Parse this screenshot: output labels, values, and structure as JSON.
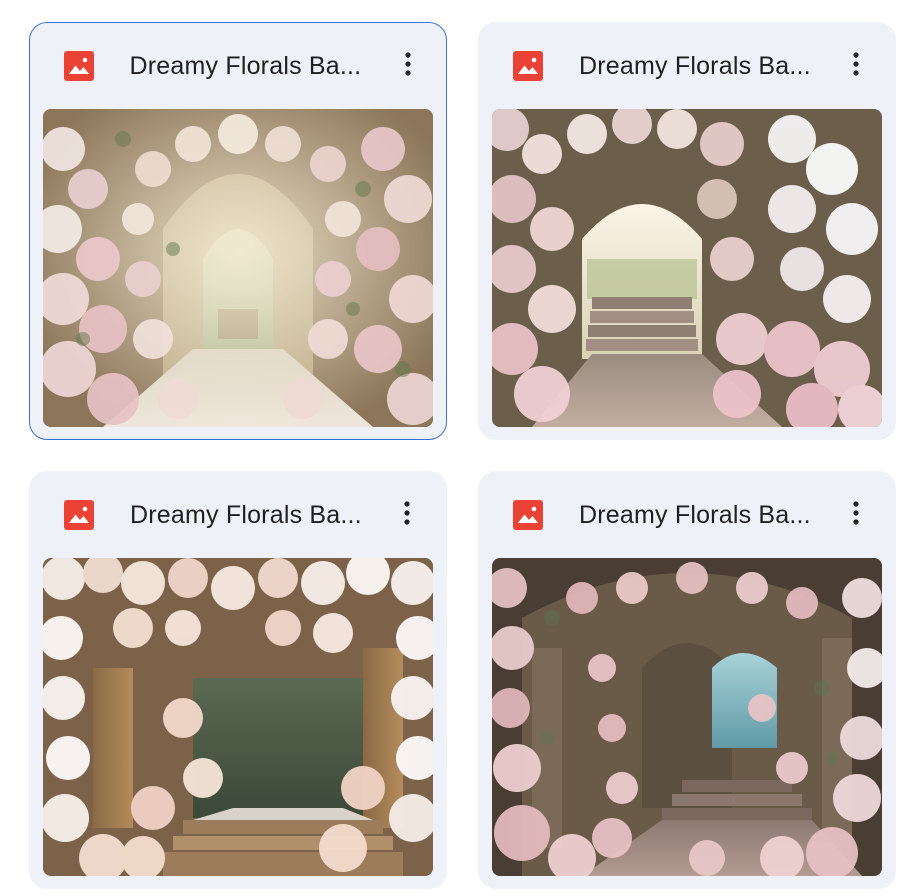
{
  "files": [
    {
      "title": "Dreamy Florals Ba...",
      "icon": "image-file-icon",
      "selected": true,
      "scene": "arch-corridor"
    },
    {
      "title": "Dreamy Florals Ba...",
      "icon": "image-file-icon",
      "selected": false,
      "scene": "garden-steps"
    },
    {
      "title": "Dreamy Florals Ba...",
      "icon": "image-file-icon",
      "selected": false,
      "scene": "white-arch-steps"
    },
    {
      "title": "Dreamy Florals Ba...",
      "icon": "image-file-icon",
      "selected": false,
      "scene": "blue-door-arch"
    }
  ],
  "colors": {
    "icon_red": "#ea4335",
    "card_bg": "#eef2f8",
    "selected_border": "#3f6fd8",
    "title_text": "#1f1f1f"
  }
}
